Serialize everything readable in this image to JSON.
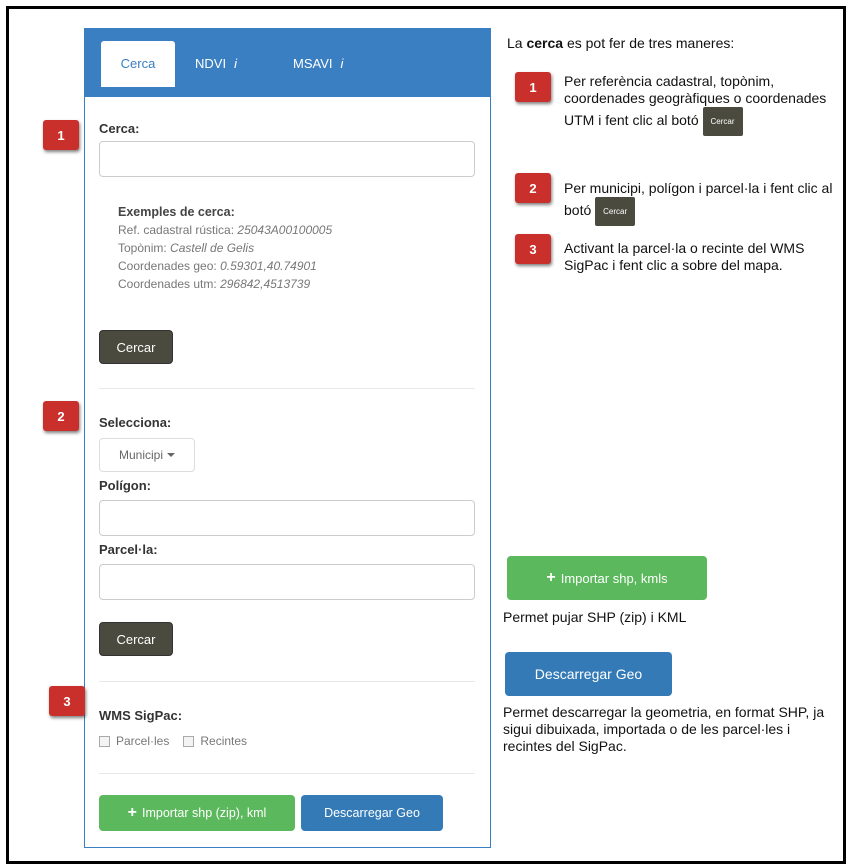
{
  "tabs": [
    {
      "label": "Cerca"
    },
    {
      "label": "NDVI",
      "info": "i"
    },
    {
      "label": "MSAVI",
      "info": "i"
    }
  ],
  "search": {
    "badge": "1",
    "label": "Cerca:",
    "value": "",
    "examples_title": "Exemples de cerca:",
    "examples": [
      {
        "prefix": "Ref. cadastral rústica: ",
        "value": "25043A00100005"
      },
      {
        "prefix": "Topònim: ",
        "value": "Castell de Gelis"
      },
      {
        "prefix": "Coordenades geo: ",
        "value": "0.59301,40.74901"
      },
      {
        "prefix": "Coordenades utm: ",
        "value": "296842,4513739"
      }
    ],
    "button": "Cercar"
  },
  "select_section": {
    "badge": "2",
    "label": "Selecciona:",
    "dropdown_value": "Municipi",
    "poligon_label": "Polígon:",
    "parcela_label": "Parcel·la:",
    "button": "Cercar"
  },
  "wms": {
    "badge": "3",
    "label": "WMS SigPac:",
    "checkbox_parceles": "Parcel·les",
    "checkbox_recintes": "Recintes"
  },
  "bottom_buttons": {
    "import": "Importar shp (zip), kml",
    "download": "Descarregar Geo"
  },
  "explain": {
    "intro_before": "La ",
    "intro_bold": "cerca",
    "intro_after": " es pot fer de tres maneres:",
    "items": [
      {
        "badge": "1",
        "text": "Per referència cadastral, topònim, coordenades geogràfiques o coordenades UTM i fent clic al botó",
        "button": "Cercar"
      },
      {
        "badge": "2",
        "text": "Per municipi, polígon i parcel·la i fent clic al botó",
        "button": "Cercar"
      },
      {
        "badge": "3",
        "text": "Activant la parcel·la o recinte del WMS SigPac i fent clic a sobre del mapa."
      }
    ],
    "import_button": "Importar shp, kmls",
    "import_desc": "Permet pujar SHP (zip) i KML",
    "download_button": "Descarregar Geo",
    "download_desc": "Permet descarregar la geometria, en format SHP, ja sigui dibuixada, importada o de les parcel·les i recintes del SigPac."
  },
  "colors": {
    "header_blue": "#3a7fc1",
    "badge_red": "#c9302c",
    "dark_button": "#4a4a3e",
    "green_button": "#5cb85c",
    "blue_button": "#337ab7"
  }
}
